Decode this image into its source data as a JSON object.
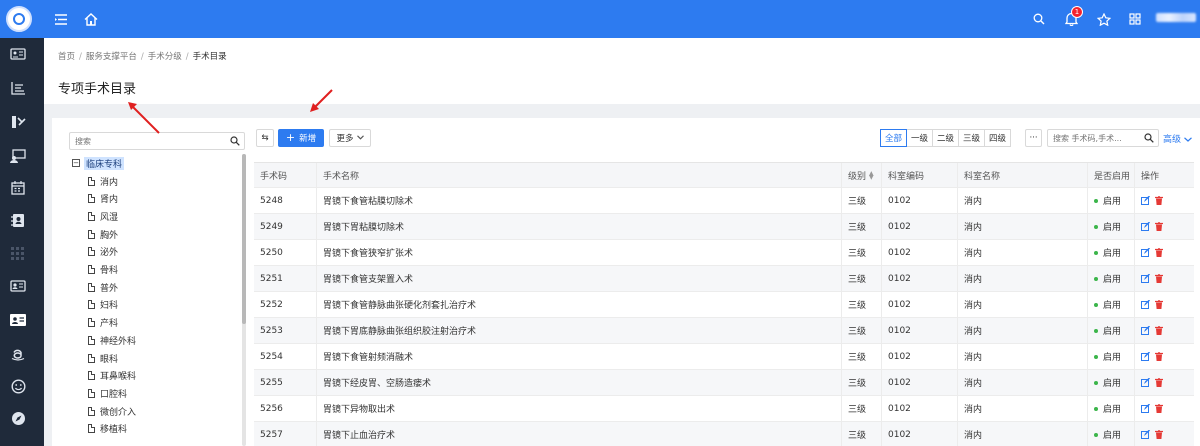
{
  "topbar": {
    "notification_count": "1",
    "colors": {
      "bar": "#2d7bf0",
      "badge": "#f5222d"
    },
    "icons": [
      "menu-icon",
      "home-icon",
      "search-icon",
      "bell-icon",
      "star-icon",
      "apps-icon"
    ]
  },
  "sidebar": {
    "icons": [
      "id-card-icon",
      "list-icon",
      "tools-icon",
      "monitor-user-icon",
      "calendar-icon",
      "contact-book-icon",
      "grid-icon",
      "profile-card-icon",
      "profile-card-active-icon",
      "amazon-icon",
      "smile-icon",
      "compass-icon"
    ]
  },
  "breadcrumb": [
    "首页",
    "服务支撑平台",
    "手术分级",
    "手术目录"
  ],
  "page_title": "专项手术目录",
  "tree": {
    "search_placeholder": "搜索",
    "root": {
      "toggle": "−",
      "label": "临床专科"
    },
    "children": [
      "消内",
      "肾内",
      "风湿",
      "胸外",
      "泌外",
      "骨科",
      "普外",
      "妇科",
      "产科",
      "神经外科",
      "眼科",
      "耳鼻喉科",
      "口腔科",
      "微创介入",
      "移植科"
    ]
  },
  "toolbar": {
    "swap_label": "⇆",
    "add_label": "新增",
    "more_label": "更多",
    "levels": [
      "全部",
      "一级",
      "二级",
      "三级",
      "四级"
    ],
    "more_dots": "···",
    "search_placeholder": "搜索 手术码,手术...",
    "advanced_label": "高级"
  },
  "table": {
    "columns": [
      "手术码",
      "手术名称",
      "级别",
      "科室编码",
      "科室名称",
      "是否启用",
      "操作"
    ],
    "rows": [
      {
        "code": "5248",
        "name": "胃镜下食管粘膜切除术",
        "level": "三级",
        "dept_code": "0102",
        "dept_name": "消内",
        "enabled": "启用"
      },
      {
        "code": "5249",
        "name": "胃镜下胃粘膜切除术",
        "level": "三级",
        "dept_code": "0102",
        "dept_name": "消内",
        "enabled": "启用"
      },
      {
        "code": "5250",
        "name": "胃镜下食管狭窄扩张术",
        "level": "三级",
        "dept_code": "0102",
        "dept_name": "消内",
        "enabled": "启用"
      },
      {
        "code": "5251",
        "name": "胃镜下食管支架置入术",
        "level": "三级",
        "dept_code": "0102",
        "dept_name": "消内",
        "enabled": "启用"
      },
      {
        "code": "5252",
        "name": "胃镜下食管静脉曲张硬化剂套扎治疗术",
        "level": "三级",
        "dept_code": "0102",
        "dept_name": "消内",
        "enabled": "启用"
      },
      {
        "code": "5253",
        "name": "胃镜下胃底静脉曲张组织胶注射治疗术",
        "level": "三级",
        "dept_code": "0102",
        "dept_name": "消内",
        "enabled": "启用"
      },
      {
        "code": "5254",
        "name": "胃镜下食管射频消融术",
        "level": "三级",
        "dept_code": "0102",
        "dept_name": "消内",
        "enabled": "启用"
      },
      {
        "code": "5255",
        "name": "胃镜下经皮胃、空肠造瘘术",
        "level": "三级",
        "dept_code": "0102",
        "dept_name": "消内",
        "enabled": "启用"
      },
      {
        "code": "5256",
        "name": "胃镜下异物取出术",
        "level": "三级",
        "dept_code": "0102",
        "dept_name": "消内",
        "enabled": "启用"
      },
      {
        "code": "5257",
        "name": "胃镜下止血治疗术",
        "level": "三级",
        "dept_code": "0102",
        "dept_name": "消内",
        "enabled": "启用"
      }
    ]
  },
  "colors": {
    "primary": "#2d7bf0",
    "enabled_dot": "#3bb54a",
    "delete": "#e53935",
    "sidebar": "#1f2a3a",
    "annotation": "#e02020"
  }
}
